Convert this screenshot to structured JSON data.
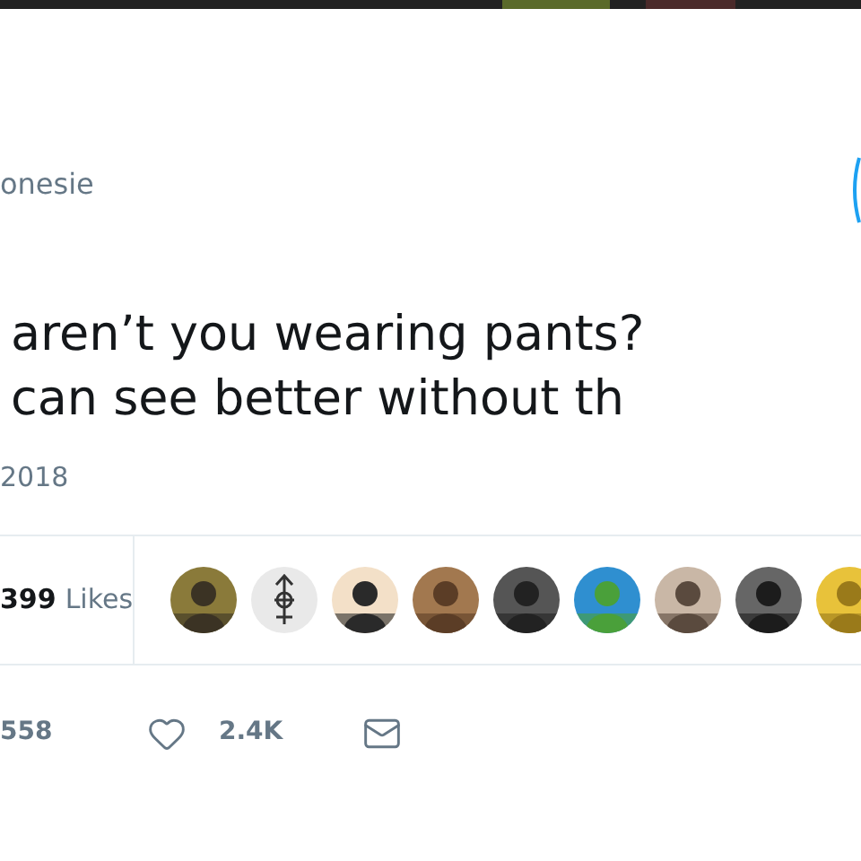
{
  "tweet": {
    "handle": "onesie",
    "text_lines": [
      "aren’t you wearing pants?",
      "can see better without th"
    ],
    "date": "2018"
  },
  "likes": {
    "count": "399",
    "label": "Likes"
  },
  "liker_avatars": [
    {
      "kind": "picture"
    },
    {
      "kind": "symbol"
    },
    {
      "kind": "picture"
    },
    {
      "kind": "picture"
    },
    {
      "kind": "picture"
    },
    {
      "kind": "picture"
    },
    {
      "kind": "picture"
    },
    {
      "kind": "picture"
    },
    {
      "kind": "picture"
    }
  ],
  "actions": {
    "retweets": "558",
    "likes": "2.4K"
  }
}
